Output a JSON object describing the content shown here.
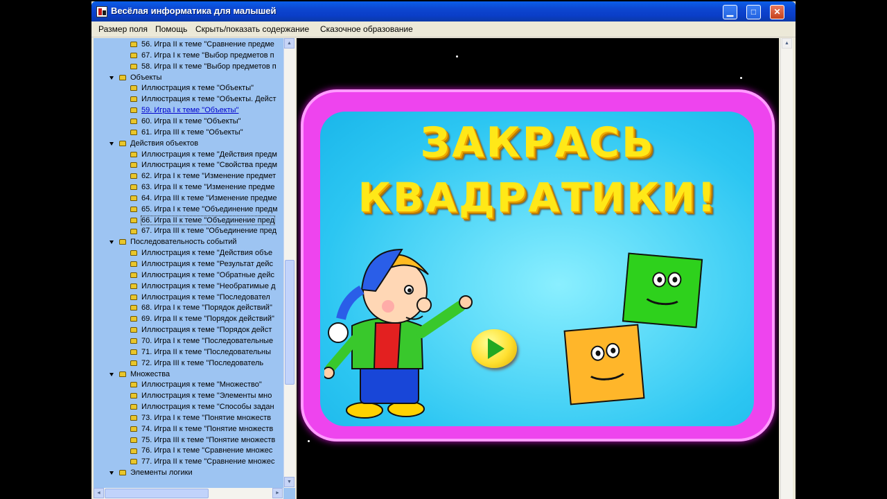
{
  "window": {
    "title": "Весёлая информатика для малышей",
    "buttons": {
      "minimize": "▁",
      "maximize": "□",
      "close": "✕"
    }
  },
  "menu": [
    "Размер поля",
    "Помощь",
    "Скрыть/показать содержание",
    "Сказочное образование"
  ],
  "tree": {
    "items": [
      {
        "text": "56. Игра II к теме \"Сравнение предме",
        "level": 2
      },
      {
        "text": "67. Игра I к теме \"Выбор предметов п",
        "level": 2
      },
      {
        "text": "58. Игра II к теме \"Выбор предметов п",
        "level": 2
      },
      {
        "text": "Объекты",
        "level": 1
      },
      {
        "text": "Иллюстрация к теме \"Объекты\"",
        "level": 2
      },
      {
        "text": "Иллюстрация к теме \"Объекты. Дейст",
        "level": 2
      },
      {
        "text": "59. Игра I к теме \"Объекты\"",
        "level": 2,
        "state": "link"
      },
      {
        "text": "60. Игра II к теме \"Объекты\"",
        "level": 2
      },
      {
        "text": "61. Игра III к теме \"Объекты\"",
        "level": 2
      },
      {
        "text": "Действия объектов",
        "level": 1
      },
      {
        "text": "Иллюстрация к теме \"Действия предм",
        "level": 2
      },
      {
        "text": "Иллюстрация к теме \"Свойства предм",
        "level": 2
      },
      {
        "text": "62. Игра I к теме \"Изменение предмет",
        "level": 2
      },
      {
        "text": "63. Игра II к теме \"Изменение предме",
        "level": 2
      },
      {
        "text": "64. Игра III к теме \"Изменение предме",
        "level": 2
      },
      {
        "text": "65. Игра I к теме \"Объединение предм",
        "level": 2
      },
      {
        "text": "66. Игра II к теме \"Объединение пред",
        "level": 2,
        "state": "selected"
      },
      {
        "text": "67. Игра III к теме \"Объединение пред",
        "level": 2
      },
      {
        "text": "Последовательность событий",
        "level": 1
      },
      {
        "text": "Иллюстрация к теме \"Действия объе",
        "level": 2
      },
      {
        "text": "Иллюстрация к теме \"Результат дейс",
        "level": 2
      },
      {
        "text": "Иллюстрация к теме \"Обратные дейс",
        "level": 2
      },
      {
        "text": "Иллюстрация к теме \"Необратимые д",
        "level": 2
      },
      {
        "text": "Иллюстрация к теме \"Последовател",
        "level": 2
      },
      {
        "text": "68. Игра I к теме \"Порядок действий\"",
        "level": 2
      },
      {
        "text": "69. Игра II к теме \"Порядок действий\"",
        "level": 2
      },
      {
        "text": "Иллюстрация к теме \"Порядок дейст",
        "level": 2
      },
      {
        "text": "70. Игра I к теме \"Последовательные",
        "level": 2
      },
      {
        "text": "71. Игра II к теме \"Последовательны",
        "level": 2
      },
      {
        "text": "72. Игра III к теме \"Последователь",
        "level": 2
      },
      {
        "text": "Множества",
        "level": 1
      },
      {
        "text": "Иллюстрация к теме \"Множество\"",
        "level": 2
      },
      {
        "text": "Иллюстрация к теме \"Элементы мно",
        "level": 2
      },
      {
        "text": "Иллюстрация к теме \"Способы задан",
        "level": 2
      },
      {
        "text": "73. Игра I к теме \"Понятие множеств",
        "level": 2
      },
      {
        "text": "74. Игра II к теме \"Понятие множеств",
        "level": 2
      },
      {
        "text": "75. Игра III к теме \"Понятие множеств",
        "level": 2
      },
      {
        "text": "76. Игра I к теме \"Сравнение множес",
        "level": 2
      },
      {
        "text": "77. Игра II к теме \"Сравнение множес",
        "level": 2
      },
      {
        "text": "Элементы логики",
        "level": 1
      }
    ]
  },
  "game": {
    "title_line1": "ЗАКРАСЬ",
    "title_line2": "КВАДРАТИКИ!"
  },
  "colors": {
    "titlebar": "#0a46d0",
    "tree_bg": "#9dc4f2",
    "frame": "#ee44ee",
    "board": "#2cc6f2",
    "title_text": "#ffe818"
  }
}
